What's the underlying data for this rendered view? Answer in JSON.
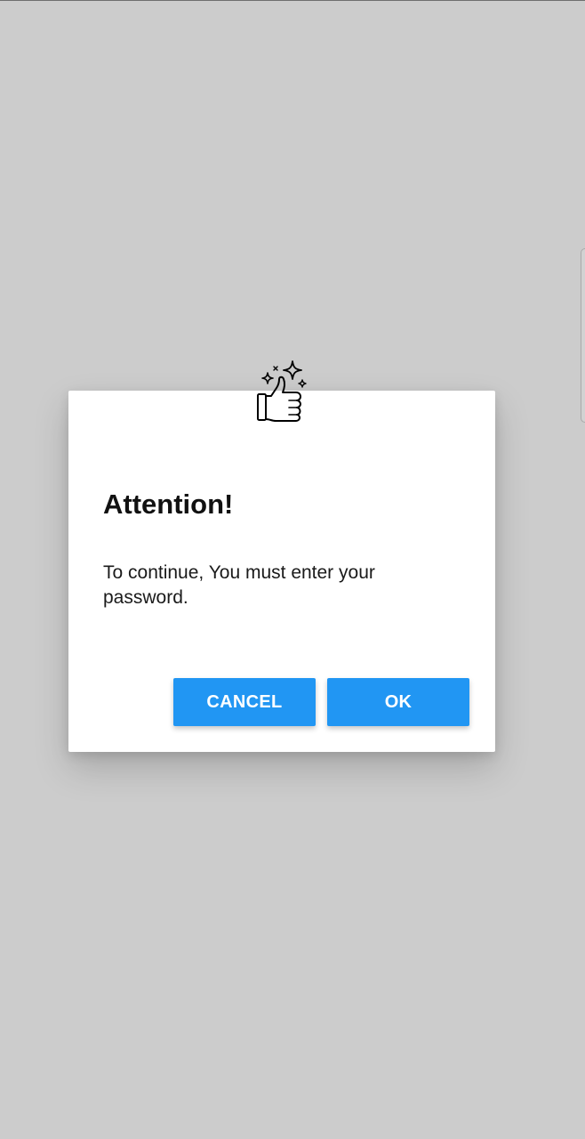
{
  "dialog": {
    "icon": "thumbs-up-sparkles-icon",
    "title": "Attention!",
    "message": "To continue, You must enter your password.",
    "cancel_label": "CANCEL",
    "ok_label": "OK"
  },
  "colors": {
    "background": "#cccccc",
    "button": "#2196f3",
    "dialog": "#ffffff"
  }
}
